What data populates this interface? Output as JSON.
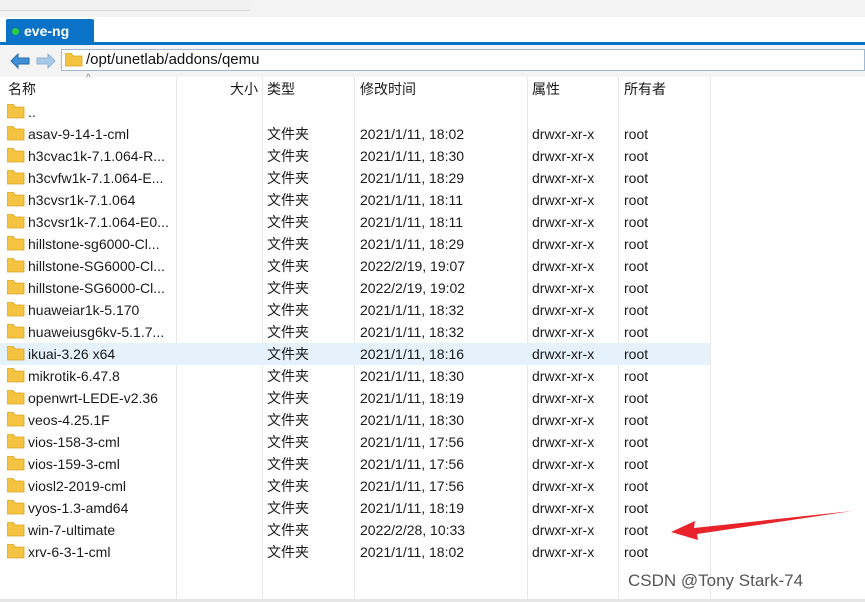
{
  "tab": {
    "label": "eve-ng"
  },
  "path": {
    "value": "/opt/unetlab/addons/qemu"
  },
  "columns": {
    "name": "名称",
    "size": "大小",
    "type": "类型",
    "modified": "修改时间",
    "attributes": "属性",
    "owner": "所有者"
  },
  "parent_label": "..",
  "files": [
    {
      "name": "asav-9-14-1-cml",
      "type": "文件夹",
      "modified": "2021/1/11, 18:02",
      "attr": "drwxr-xr-x",
      "owner": "root"
    },
    {
      "name": "h3cvac1k-7.1.064-R...",
      "type": "文件夹",
      "modified": "2021/1/11, 18:30",
      "attr": "drwxr-xr-x",
      "owner": "root"
    },
    {
      "name": "h3cvfw1k-7.1.064-E...",
      "type": "文件夹",
      "modified": "2021/1/11, 18:29",
      "attr": "drwxr-xr-x",
      "owner": "root"
    },
    {
      "name": "h3cvsr1k-7.1.064",
      "type": "文件夹",
      "modified": "2021/1/11, 18:11",
      "attr": "drwxr-xr-x",
      "owner": "root"
    },
    {
      "name": "h3cvsr1k-7.1.064-E0...",
      "type": "文件夹",
      "modified": "2021/1/11, 18:11",
      "attr": "drwxr-xr-x",
      "owner": "root"
    },
    {
      "name": "hillstone-sg6000-Cl...",
      "type": "文件夹",
      "modified": "2021/1/11, 18:29",
      "attr": "drwxr-xr-x",
      "owner": "root"
    },
    {
      "name": "hillstone-SG6000-Cl...",
      "type": "文件夹",
      "modified": "2022/2/19, 19:07",
      "attr": "drwxr-xr-x",
      "owner": "root"
    },
    {
      "name": "hillstone-SG6000-Cl...",
      "type": "文件夹",
      "modified": "2022/2/19, 19:02",
      "attr": "drwxr-xr-x",
      "owner": "root"
    },
    {
      "name": "huaweiar1k-5.170",
      "type": "文件夹",
      "modified": "2021/1/11, 18:32",
      "attr": "drwxr-xr-x",
      "owner": "root"
    },
    {
      "name": "huaweiusg6kv-5.1.7...",
      "type": "文件夹",
      "modified": "2021/1/11, 18:32",
      "attr": "drwxr-xr-x",
      "owner": "root"
    },
    {
      "name": "ikuai-3.26 x64",
      "type": "文件夹",
      "modified": "2021/1/11, 18:16",
      "attr": "drwxr-xr-x",
      "owner": "root"
    },
    {
      "name": "mikrotik-6.47.8",
      "type": "文件夹",
      "modified": "2021/1/11, 18:30",
      "attr": "drwxr-xr-x",
      "owner": "root"
    },
    {
      "name": "openwrt-LEDE-v2.36",
      "type": "文件夹",
      "modified": "2021/1/11, 18:19",
      "attr": "drwxr-xr-x",
      "owner": "root"
    },
    {
      "name": "veos-4.25.1F",
      "type": "文件夹",
      "modified": "2021/1/11, 18:30",
      "attr": "drwxr-xr-x",
      "owner": "root"
    },
    {
      "name": "vios-158-3-cml",
      "type": "文件夹",
      "modified": "2021/1/11, 17:56",
      "attr": "drwxr-xr-x",
      "owner": "root"
    },
    {
      "name": "vios-159-3-cml",
      "type": "文件夹",
      "modified": "2021/1/11, 17:56",
      "attr": "drwxr-xr-x",
      "owner": "root"
    },
    {
      "name": "viosl2-2019-cml",
      "type": "文件夹",
      "modified": "2021/1/11, 17:56",
      "attr": "drwxr-xr-x",
      "owner": "root"
    },
    {
      "name": "vyos-1.3-amd64",
      "type": "文件夹",
      "modified": "2021/1/11, 18:19",
      "attr": "drwxr-xr-x",
      "owner": "root"
    },
    {
      "name": "win-7-ultimate",
      "type": "文件夹",
      "modified": "2022/2/28, 10:33",
      "attr": "drwxr-xr-x",
      "owner": "root"
    },
    {
      "name": "xrv-6-3-1-cml",
      "type": "文件夹",
      "modified": "2021/1/11, 18:02",
      "attr": "drwxr-xr-x",
      "owner": "root"
    }
  ],
  "selected_index": 10,
  "watermark": "CSDN @Tony Stark-74",
  "colors": {
    "tab_blue": "#0a73c8",
    "folder_yellow": "#f5c342",
    "selection": "#e5f1fb",
    "arrow_red": "#e8232a"
  }
}
